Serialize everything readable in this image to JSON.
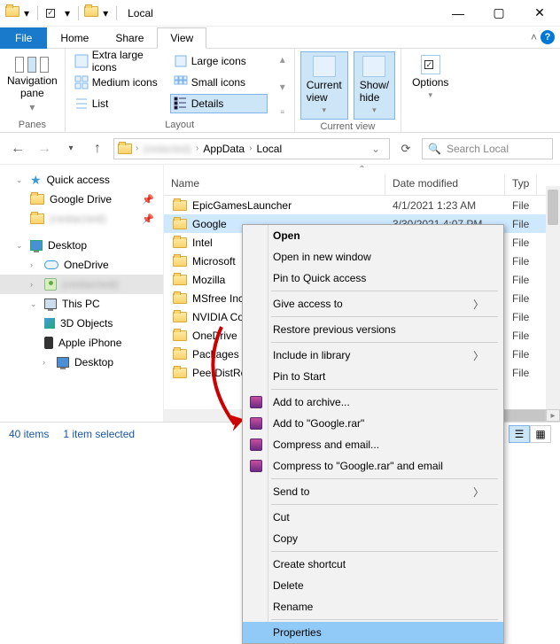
{
  "title": "Local",
  "tabs": {
    "file": "File",
    "home": "Home",
    "share": "Share",
    "view": "View"
  },
  "ribbon": {
    "panes_label": "Panes",
    "layout_label": "Layout",
    "current_label": "Current view",
    "nav_pane": "Navigation\npane",
    "icons": {
      "xl": "Extra large icons",
      "l": "Large icons",
      "m": "Medium icons",
      "s": "Small icons",
      "list": "List",
      "details": "Details"
    },
    "current_view": "Current\nview",
    "show_hide": "Show/\nhide",
    "options": "Options"
  },
  "breadcrumb": {
    "seg1": "(redacted)",
    "seg2": "AppData",
    "seg3": "Local"
  },
  "search_placeholder": "Search Local",
  "nav": {
    "quick": "Quick access",
    "gdrive": "Google Drive",
    "redacted": "(redacted)",
    "desktop": "Desktop",
    "onedrive": "OneDrive",
    "user": "(redacted)",
    "thispc": "This PC",
    "obj3d": "3D Objects",
    "iphone": "Apple iPhone",
    "desktop2": "Desktop"
  },
  "cols": {
    "name": "Name",
    "date": "Date modified",
    "type": "Typ"
  },
  "rows": [
    {
      "n": "EpicGamesLauncher",
      "d": "4/1/2021 1:23 AM",
      "t": "File"
    },
    {
      "n": "Google",
      "d": "3/30/2021 4:07 PM",
      "t": "File",
      "sel": true
    },
    {
      "n": "Intel",
      "d": "",
      "t": "File"
    },
    {
      "n": "Microsoft",
      "d": "",
      "t": "File"
    },
    {
      "n": "Mozilla",
      "d": "",
      "t": "File"
    },
    {
      "n": "MSfree Inc",
      "d": "",
      "t": "File"
    },
    {
      "n": "NVIDIA Co",
      "d": "",
      "t": "File"
    },
    {
      "n": "OneDrive",
      "d": "",
      "t": "File"
    },
    {
      "n": "Packages",
      "d": "",
      "t": "File"
    },
    {
      "n": "PeerDistRe",
      "d": "",
      "t": "File"
    }
  ],
  "status": {
    "items": "40 items",
    "sel": "1 item selected"
  },
  "ctx": {
    "open": "Open",
    "open_new": "Open in new window",
    "pin_quick": "Pin to Quick access",
    "give": "Give access to",
    "restore": "Restore previous versions",
    "include": "Include in library",
    "pin_start": "Pin to Start",
    "add_arch": "Add to archive...",
    "add_rar": "Add to \"Google.rar\"",
    "comp_email": "Compress and email...",
    "comp_rar_email": "Compress to \"Google.rar\" and email",
    "send": "Send to",
    "cut": "Cut",
    "copy": "Copy",
    "shortcut": "Create shortcut",
    "delete": "Delete",
    "rename": "Rename",
    "props": "Properties"
  }
}
